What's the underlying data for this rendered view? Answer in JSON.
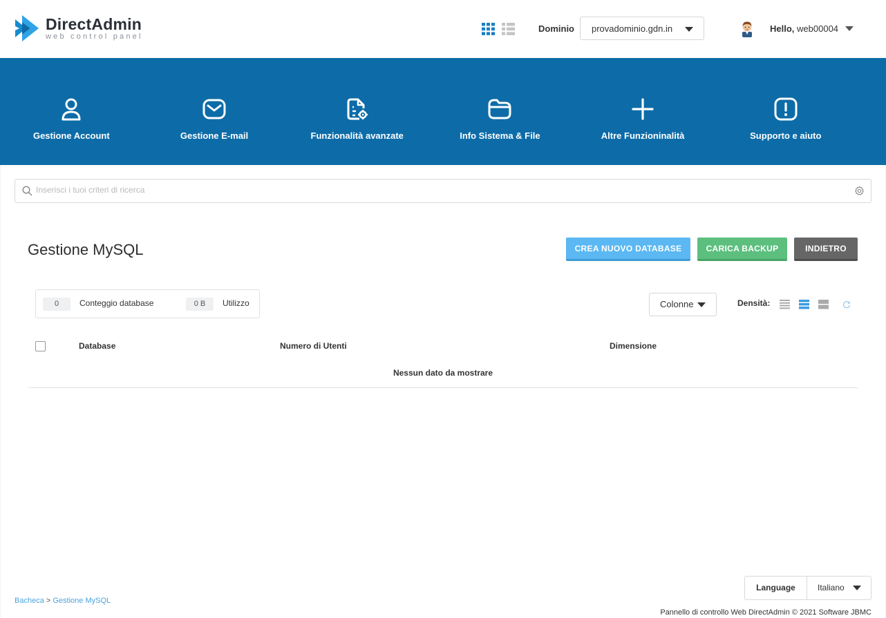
{
  "brand": {
    "title": "DirectAdmin",
    "subtitle": "web control panel"
  },
  "header": {
    "domain_label": "Dominio",
    "domain_value": "provadominio.gdn.in",
    "hello": "Hello,",
    "username": "web00004"
  },
  "nav": {
    "items": [
      {
        "label": "Gestione Account",
        "icon": "user-icon"
      },
      {
        "label": "Gestione E-mail",
        "icon": "envelope-icon"
      },
      {
        "label": "Funzionalità avanzate",
        "icon": "document-gear-icon"
      },
      {
        "label": "Info Sistema & File",
        "icon": "folder-icon"
      },
      {
        "label": "Altre Funzioninalità",
        "icon": "plus-icon"
      },
      {
        "label": "Supporto e aiuto",
        "icon": "exclamation-icon"
      }
    ]
  },
  "search": {
    "placeholder": "Inserisci i tuoi criteri di ricerca"
  },
  "page": {
    "title": "Gestione MySQL"
  },
  "actions": {
    "create": "CREA NUOVO DATABASE",
    "backup": "CARICA BACKUP",
    "back": "INDIETRO"
  },
  "stats": {
    "db_count_value": "0",
    "db_count_label": "Conteggio database",
    "usage_value": "0 B",
    "usage_label": "Utilizzo"
  },
  "table": {
    "columns_button": "Colonne",
    "density_label": "Densità:",
    "headers": [
      "Database",
      "Numero di Utenti",
      "Dimensione"
    ],
    "empty_message": "Nessun dato da mostrare"
  },
  "language": {
    "label": "Language",
    "value": "Italiano"
  },
  "breadcrumb": {
    "items": [
      "Bacheca",
      "Gestione MySQL"
    ],
    "separator": ">"
  },
  "footer": {
    "text": "Pannello di controllo Web DirectAdmin © 2021 Software JBMC"
  },
  "colors": {
    "nav_bg": "#0d6ca8",
    "create_btn": "#5bb8f2",
    "backup_btn": "#5cbf7e",
    "back_btn": "#666666",
    "link": "#4aa3df"
  }
}
